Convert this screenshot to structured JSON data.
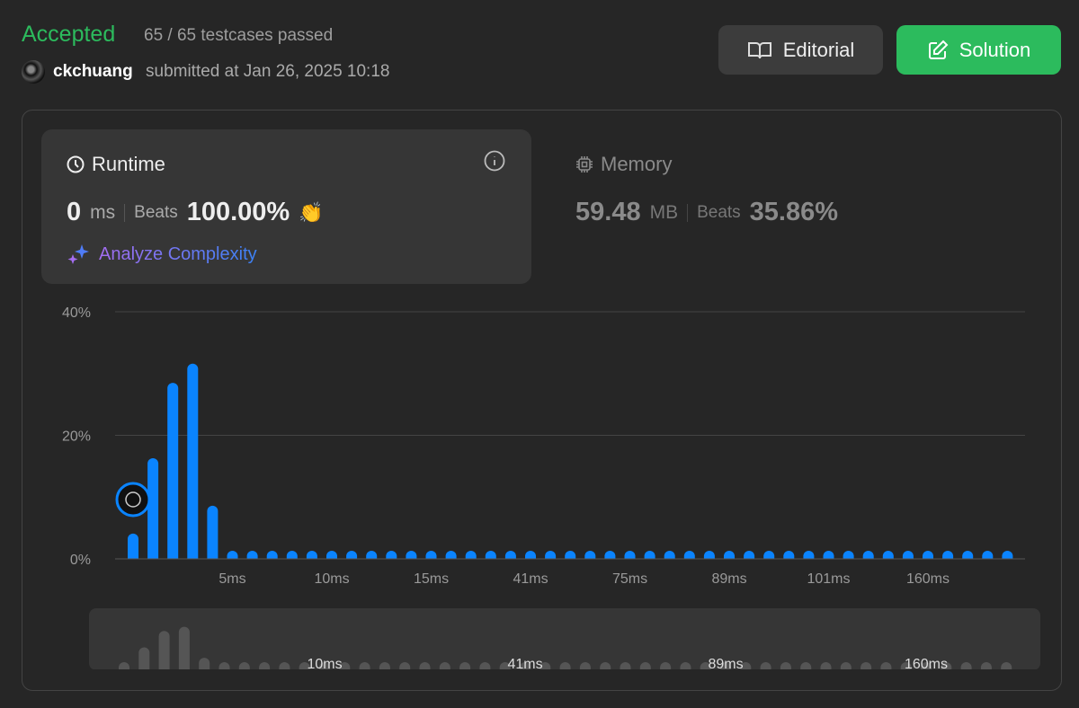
{
  "header": {
    "status": "Accepted",
    "testcases": "65 / 65 testcases passed",
    "username": "ckchuang",
    "submitted": "submitted at Jan 26, 2025 10:18"
  },
  "buttons": {
    "editorial": "Editorial",
    "solution": "Solution"
  },
  "runtime": {
    "title": "Runtime",
    "value": "0",
    "unit": "ms",
    "beats_label": "Beats",
    "beats": "100.00%",
    "analyze": "Analyze Complexity"
  },
  "memory": {
    "title": "Memory",
    "value": "59.48",
    "unit": "MB",
    "beats_label": "Beats",
    "beats": "35.86%"
  },
  "colors": {
    "accepted": "#2cbb5d",
    "bar": "#0a84ff",
    "minimap_bar": "#555555"
  },
  "chart_data": {
    "type": "bar",
    "ylabel": "",
    "xlabel": "",
    "ylim": [
      0,
      40
    ],
    "y_ticks": [
      "0%",
      "20%",
      "40%"
    ],
    "x_tick_labels": [
      {
        "index": 5,
        "label": "5ms"
      },
      {
        "index": 10,
        "label": "10ms"
      },
      {
        "index": 15,
        "label": "15ms"
      },
      {
        "index": 20,
        "label": "41ms"
      },
      {
        "index": 25,
        "label": "75ms"
      },
      {
        "index": 30,
        "label": "89ms"
      },
      {
        "index": 35,
        "label": "101ms"
      },
      {
        "index": 40,
        "label": "160ms"
      }
    ],
    "minimap_labels": [
      {
        "index": 10,
        "label": "10ms"
      },
      {
        "index": 20,
        "label": "41ms"
      },
      {
        "index": 30,
        "label": "89ms"
      },
      {
        "index": 40,
        "label": "160ms"
      }
    ],
    "values": [
      4.1,
      16.3,
      28.5,
      31.6,
      8.6,
      0.5,
      0.5,
      0.5,
      0.5,
      0.5,
      0.5,
      0.5,
      0.5,
      0.5,
      0.5,
      0.5,
      0.5,
      0.5,
      0.5,
      0.5,
      0.5,
      0.5,
      0.5,
      0.5,
      0.5,
      0.5,
      0.5,
      0.5,
      0.5,
      0.5,
      0.5,
      0.5,
      0.5,
      0.5,
      0.5,
      0.5,
      0.5,
      0.5,
      0.5,
      0.5,
      0.5,
      0.5,
      0.5,
      0.5,
      0.5
    ],
    "user_bar_index": 0,
    "grid": true
  }
}
